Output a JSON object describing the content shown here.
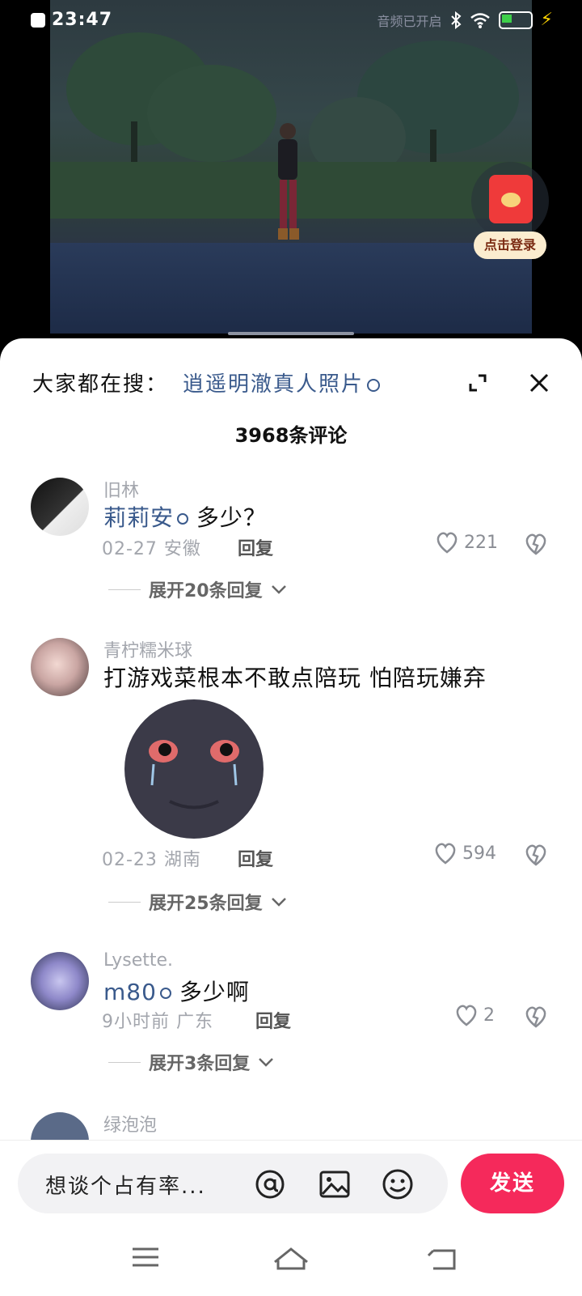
{
  "status_bar": {
    "time": "23:47",
    "right_text": "音频已开启"
  },
  "video": {
    "login_badge": "点击登录"
  },
  "sheet": {
    "search_prefix": "大家都在搜：",
    "search_term": "逍遥明澈真人照片",
    "comment_count": "3968条评论"
  },
  "comments": [
    {
      "username": "旧林",
      "mention": "莉莉安",
      "text": "多少？",
      "date_location": "02-27 安徽",
      "reply_label": "回复",
      "likes": "221",
      "expand_label": "展开20条回复"
    },
    {
      "username": "青柠糯米球",
      "mention": "",
      "text": "打游戏菜根本不敢点陪玩 怕陪玩嫌弃",
      "date_location": "02-23 湖南",
      "reply_label": "回复",
      "likes": "594",
      "expand_label": "展开25条回复"
    },
    {
      "username": "Lysette.",
      "mention": "m80",
      "text": "多少啊",
      "date_location": "9小时前 广东",
      "reply_label": "回复",
      "likes": "2",
      "expand_label": "展开3条回复"
    },
    {
      "username": "绿泡泡"
    }
  ],
  "bottom": {
    "placeholder": "想谈个占有率...",
    "send_label": "发送"
  },
  "colors": {
    "accent_send": "#f5295b",
    "mention": "#3a5a8c",
    "muted": "#a3a6ad"
  },
  "icons": [
    "at-icon",
    "image-icon",
    "emoji-icon",
    "heart-icon",
    "broken-heart-icon",
    "expand-icon",
    "close-icon",
    "search-icon",
    "menu-icon",
    "home-icon",
    "back-icon"
  ]
}
